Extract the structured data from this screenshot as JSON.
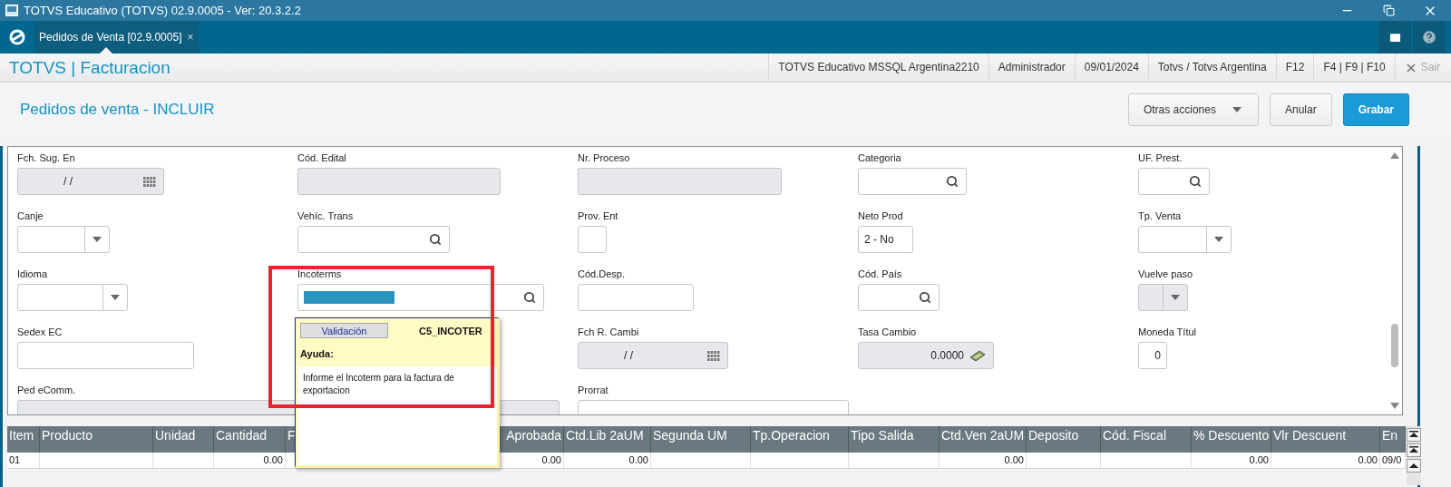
{
  "window": {
    "title": "TOTVS Educativo (TOTVS) 02.9.0005 - Ver: 20.3.2.2"
  },
  "tabs": [
    {
      "label": "Pedidos de Venta [02.9.0005]",
      "close": "×",
      "selected": true
    }
  ],
  "header": {
    "module": "TOTVS | Facturacion",
    "info": [
      "TOTVS Educativo MSSQL Argentina2210",
      "Administrador",
      "09/01/2024",
      "Totvs / Totvs Argentina",
      "F12",
      "F4 | F9 | F10"
    ],
    "exit": {
      "label": "Sair",
      "disabled": true
    }
  },
  "page": {
    "title": "Pedidos de venta - INCLUIR",
    "actions": [
      {
        "label": "Otras acciones",
        "kind": "menu"
      },
      {
        "label": "Anular",
        "kind": "default"
      },
      {
        "label": "Grabar",
        "kind": "primary"
      }
    ]
  },
  "form": {
    "fields": [
      {
        "label": "Fch. Sug. En",
        "kind": "date",
        "disabled": true,
        "value": "/ /"
      },
      {
        "label": "Cód. Edital",
        "kind": "text",
        "disabled": true
      },
      {
        "label": "Nr. Proceso",
        "kind": "text",
        "disabled": true
      },
      {
        "label": "Categoria",
        "kind": "search",
        "disabled": false
      },
      {
        "label": "UF. Prest.",
        "kind": "search",
        "disabled": false
      },
      {
        "label": "Canje",
        "kind": "select",
        "disabled": false
      },
      {
        "label": "Vehíc. Trans",
        "kind": "search",
        "disabled": false
      },
      {
        "label": "Prov. Ent",
        "kind": "text",
        "disabled": false
      },
      {
        "label": "Neto Prod",
        "kind": "select",
        "disabled": false,
        "value": "2 - No"
      },
      {
        "label": "Tp. Venta",
        "kind": "select",
        "disabled": false
      },
      {
        "label": "Idioma",
        "kind": "select",
        "disabled": false
      },
      {
        "label": "Incoterms",
        "kind": "search",
        "disabled": false,
        "highlighted": true
      },
      {
        "label": "Cód.Desp.",
        "kind": "text",
        "disabled": false
      },
      {
        "label": "Cód. País",
        "kind": "search",
        "disabled": false
      },
      {
        "label": "Vuelve paso",
        "kind": "select",
        "disabled": true
      },
      {
        "label": "Sedex EC",
        "kind": "text",
        "disabled": false
      },
      {
        "label": "Fch R. Cambi",
        "kind": "date",
        "disabled": true,
        "value": "/ /"
      },
      {
        "label": "Tasa Cambio",
        "kind": "money",
        "disabled": true,
        "value": "0.0000"
      },
      {
        "label": "Moneda Títul",
        "kind": "number",
        "disabled": false,
        "value": "0"
      },
      {
        "label": "Ped eComm.",
        "kind": "text",
        "disabled": true
      },
      {
        "label": "Prorrat",
        "kind": "text",
        "disabled": false
      }
    ]
  },
  "help_popup": {
    "tab": "Validación",
    "field_code": "C5_INCOTER",
    "title": "Ayuda:",
    "text": "Informe el Incoterm para la factura de exportacion"
  },
  "table": {
    "columns": [
      {
        "label": "Item"
      },
      {
        "label": "Producto"
      },
      {
        "label": "Unidad"
      },
      {
        "label": "Cantidad"
      },
      {
        "label": "F"
      },
      {},
      {
        "label": "Aprobada"
      },
      {
        "label": "Ctd.Lib 2aUM"
      },
      {
        "label": "Segunda UM"
      },
      {
        "label": "Tp.Operacion"
      },
      {
        "label": "Tipo Salida"
      },
      {
        "label": "Ctd.Ven 2aUM"
      },
      {
        "label": "Deposito"
      },
      {
        "label": "Cód. Fiscal"
      },
      {
        "label": "% Descuento"
      },
      {
        "label": "Vlr Descuent"
      },
      {
        "label": "En"
      }
    ],
    "rows": [
      {
        "cells": [
          "01",
          null,
          null,
          "0.00",
          null,
          null,
          "0.00",
          "0.00",
          null,
          null,
          null,
          "0.00",
          null,
          null,
          "0.00",
          "0.00",
          "09/0"
        ]
      }
    ]
  }
}
